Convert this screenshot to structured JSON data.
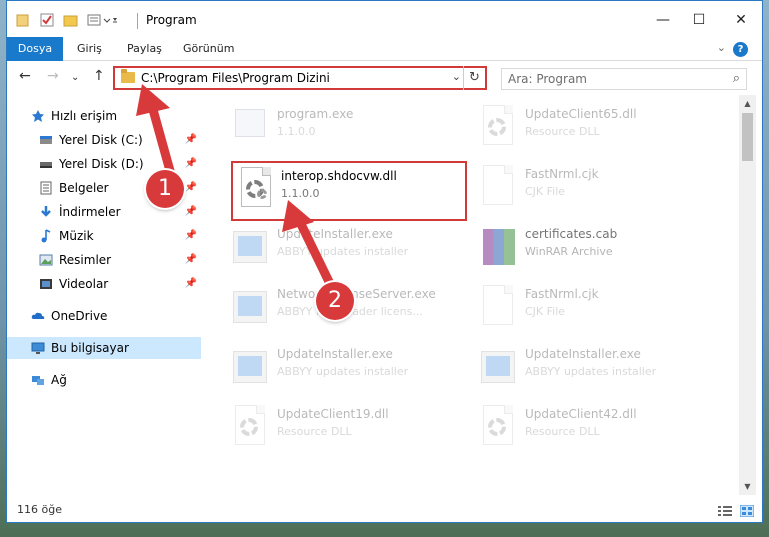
{
  "window": {
    "title": "Program",
    "controls": {
      "minimize": "—",
      "maximize": "☐",
      "close": "✕"
    }
  },
  "ribbon": {
    "tabs": [
      {
        "label": "Dosya"
      },
      {
        "label": "Giriş"
      },
      {
        "label": "Paylaş"
      },
      {
        "label": "Görünüm"
      }
    ],
    "help": "?"
  },
  "address": {
    "path": "C:\\Program Files\\Program Dizini",
    "search_placeholder": "Ara: Program"
  },
  "nav": {
    "items": [
      {
        "label": "Hızlı erişim",
        "icon": "star-icon"
      },
      {
        "label": "Yerel Disk (C:)",
        "icon": "drive-icon",
        "pinned": true
      },
      {
        "label": "Yerel Disk (D:)",
        "icon": "drive-icon",
        "pinned": true
      },
      {
        "label": "Belgeler",
        "icon": "documents-icon",
        "pinned": true
      },
      {
        "label": "İndirmeler",
        "icon": "download-icon",
        "pinned": true
      },
      {
        "label": "Müzik",
        "icon": "music-icon",
        "pinned": true
      },
      {
        "label": "Resimler",
        "icon": "pictures-icon",
        "pinned": true
      },
      {
        "label": "Videolar",
        "icon": "videos-icon",
        "pinned": true
      },
      {
        "label": "OneDrive",
        "icon": "cloud-icon"
      },
      {
        "label": "Bu bilgisayar",
        "icon": "computer-icon",
        "selected": true
      },
      {
        "label": "Ağ",
        "icon": "network-icon"
      }
    ]
  },
  "files": [
    {
      "name": "program.exe",
      "sub": "1.1.0.0",
      "icon": "exe-icon"
    },
    {
      "name": "UpdateClient65.dll",
      "sub": "Resource DLL",
      "icon": "dll-icon"
    },
    {
      "name": "interop.shdocvw.dll",
      "sub": "1.1.0.0",
      "icon": "dll-icon"
    },
    {
      "name": "FastNrml.cjk",
      "sub": "CJK File",
      "icon": "blank-file-icon"
    },
    {
      "name": "UpdateInstaller.exe",
      "sub": "ABBYY updates installer",
      "icon": "installer-icon"
    },
    {
      "name": "certificates.cab",
      "sub": "WinRAR Archive",
      "icon": "winrar-icon"
    },
    {
      "name": "NetworkLicenseServer.exe",
      "sub": "ABBYY FineReader licens...",
      "icon": "installer-icon"
    },
    {
      "name": "FastNrml.cjk",
      "sub": "CJK File",
      "icon": "blank-file-icon"
    },
    {
      "name": "UpdateInstaller.exe",
      "sub": "ABBYY updates installer",
      "icon": "installer-icon"
    },
    {
      "name": "UpdateInstaller.exe",
      "sub": "ABBYY updates installer",
      "icon": "installer-icon"
    },
    {
      "name": "UpdateClient19.dll",
      "sub": "Resource DLL",
      "icon": "dll-icon"
    },
    {
      "name": "UpdateClient42.dll",
      "sub": "Resource DLL",
      "icon": "dll-icon"
    }
  ],
  "status": {
    "count": "116 öğe"
  },
  "annotations": {
    "callout1": "1",
    "callout2": "2",
    "accent": "#d8393a"
  }
}
